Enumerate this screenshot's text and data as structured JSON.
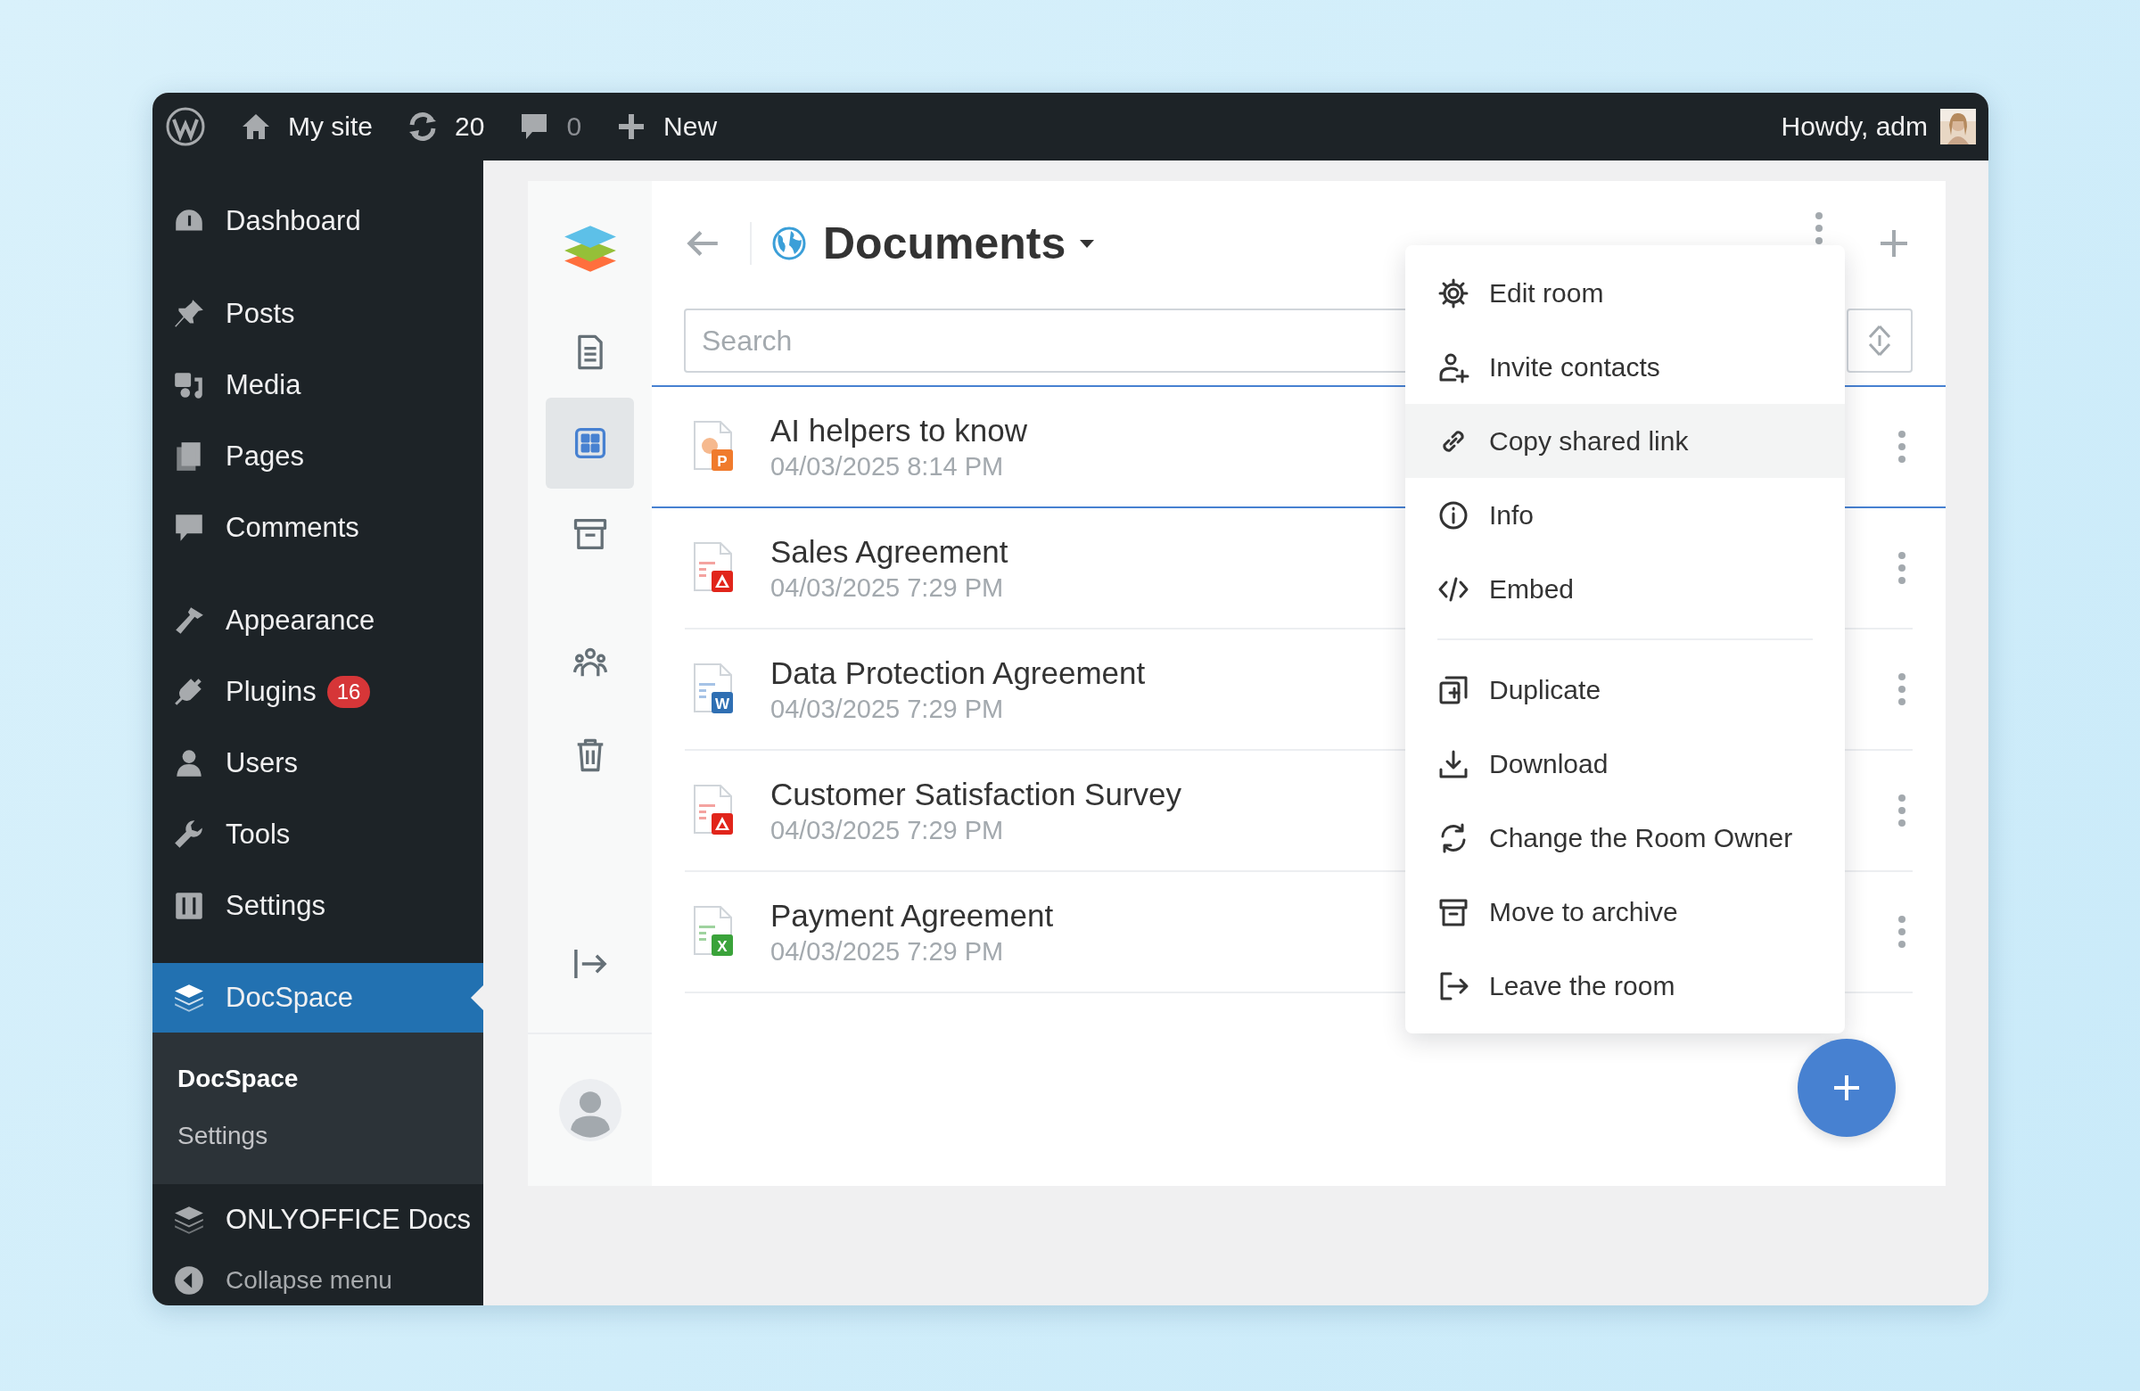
{
  "topbar": {
    "items": [
      {
        "kind": "logo"
      },
      {
        "kind": "home",
        "label": "My site"
      },
      {
        "kind": "updates",
        "label": "20"
      },
      {
        "kind": "comments",
        "label": "0"
      },
      {
        "kind": "new",
        "label": "New"
      }
    ],
    "greeting": "Howdy, adm"
  },
  "sidebar": {
    "groups": [
      [
        {
          "kind": "dashboard",
          "label": "Dashboard",
          "selected": false
        }
      ],
      [
        {
          "kind": "posts",
          "label": "Posts",
          "selected": false
        },
        {
          "kind": "media",
          "label": "Media",
          "selected": false
        },
        {
          "kind": "pages",
          "label": "Pages",
          "selected": false
        },
        {
          "kind": "comments",
          "label": "Comments",
          "selected": false
        }
      ],
      [
        {
          "kind": "appearance",
          "label": "Appearance",
          "selected": false
        },
        {
          "kind": "plugins",
          "label": "Plugins",
          "selected": false,
          "badge": "16"
        },
        {
          "kind": "users",
          "label": "Users",
          "selected": false
        },
        {
          "kind": "tools",
          "label": "Tools",
          "selected": false
        },
        {
          "kind": "settings",
          "label": "Settings",
          "selected": false
        }
      ],
      [
        {
          "kind": "docspace",
          "label": "DocSpace",
          "selected": true,
          "submenu": [
            {
              "label": "DocSpace",
              "selected": true
            },
            {
              "label": "Settings",
              "selected": false
            }
          ]
        },
        {
          "kind": "docs",
          "label": "ONLYOFFICE Docs",
          "selected": false
        }
      ]
    ],
    "collapse": {
      "label": "Collapse menu"
    }
  },
  "docspace": {
    "nav": [
      {
        "kind": "documents",
        "selected": false
      },
      {
        "kind": "rooms",
        "selected": true
      },
      {
        "kind": "archive",
        "selected": false
      },
      {
        "kind": "contacts",
        "selected": false
      },
      {
        "kind": "trash",
        "selected": false
      }
    ],
    "title": "Documents",
    "search": {
      "placeholder": "Search"
    },
    "files": [
      {
        "kind": "presentation",
        "badge": "P",
        "name": "AI helpers to know",
        "date": "04/03/2025 8:14 PM",
        "selected": true
      },
      {
        "kind": "pdf",
        "name": "Sales Agreement",
        "date": "04/03/2025 7:29 PM",
        "selected": false
      },
      {
        "kind": "document",
        "badge": "W",
        "name": "Data Protection Agreement",
        "date": "04/03/2025 7:29 PM",
        "selected": false
      },
      {
        "kind": "pdf",
        "name": "Customer Satisfaction Survey",
        "date": "04/03/2025 7:29 PM",
        "selected": false
      },
      {
        "kind": "spreadsheet",
        "badge": "X",
        "name": "Payment Agreement",
        "date": "04/03/2025 7:29 PM",
        "selected": false
      }
    ],
    "menu": {
      "groups": [
        [
          {
            "kind": "edit",
            "label": "Edit room",
            "highlighted": false
          },
          {
            "kind": "invite",
            "label": "Invite contacts",
            "highlighted": false
          },
          {
            "kind": "link",
            "label": "Copy shared link",
            "highlighted": true
          },
          {
            "kind": "info",
            "label": "Info",
            "highlighted": false
          },
          {
            "kind": "embed",
            "label": "Embed",
            "highlighted": false
          }
        ],
        [
          {
            "kind": "duplicate",
            "label": "Duplicate",
            "highlighted": false
          },
          {
            "kind": "download",
            "label": "Download",
            "highlighted": false
          },
          {
            "kind": "owner",
            "label": "Change the Room Owner",
            "highlighted": false
          },
          {
            "kind": "archive",
            "label": "Move to archive",
            "highlighted": false
          },
          {
            "kind": "leave",
            "label": "Leave the room",
            "highlighted": false
          }
        ]
      ]
    }
  }
}
